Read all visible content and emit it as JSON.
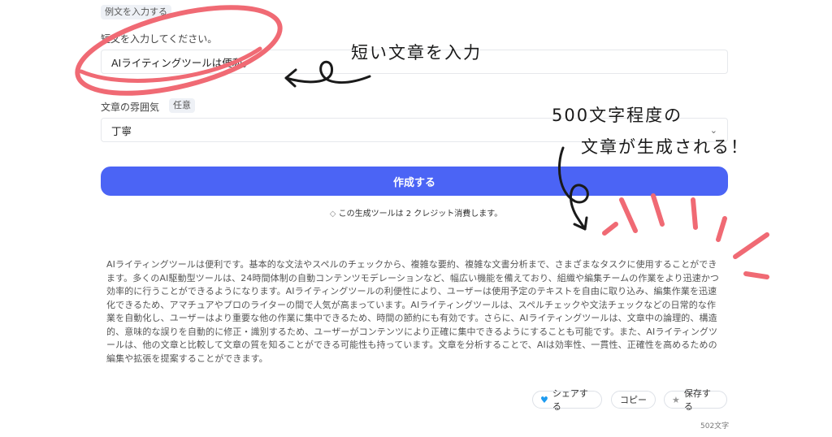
{
  "form": {
    "example_tag": "例文を入力する",
    "short_text_label": "短文を入力してください。",
    "short_text_value": "AIライティングツールは便利。",
    "tone_label": "文章の雰囲気",
    "tone_optional_tag": "任意",
    "tone_value": "丁寧",
    "generate_button": "作成する",
    "credit_note": "この生成ツールは 2 クレジット消費します。"
  },
  "output": {
    "text": "AIライティングツールは便利です。基本的な文法やスペルのチェックから、複雑な要約、複雑な文書分析まで、さまざまなタスクに使用することができます。多くのAI駆動型ツールは、24時間体制の自動コンテンツモデレーションなど、幅広い機能を備えており、組織や編集チームの作業をより迅速かつ効率的に行うことができるようになります。AIライティングツールの利便性により、ユーザーは使用予定のテキストを自由に取り込み、編集作業を迅速化できるため、アマチュアやプロのライターの間で人気が高まっています。AIライティングツールは、スペルチェックや文法チェックなどの日常的な作業を自動化し、ユーザーはより重要な他の作業に集中できるため、時間の節約にも有効です。さらに、AIライティングツールは、文章中の論理的、構造的、意味的な誤りを自動的に修正・識別するため、ユーザーがコンテンツにより正確に集中できるようにすることも可能です。また、AIライティングツールは、他の文章と比較して文章の質を知ることができる可能性も持っています。文章を分析することで、AIは効率性、一貫性、正確性を高めるための編集や拡張を提案することができます。",
    "share_button": "シェアする",
    "copy_button": "コピー",
    "save_button": "保存する",
    "char_count": "502文字"
  },
  "annotations": {
    "input_note": "短い文章を入力",
    "output_note_line1": "500文字程度の",
    "output_note_line2": "文章が生成される！"
  },
  "colors": {
    "accent": "#4b64f5",
    "marker": "#f06a74"
  }
}
